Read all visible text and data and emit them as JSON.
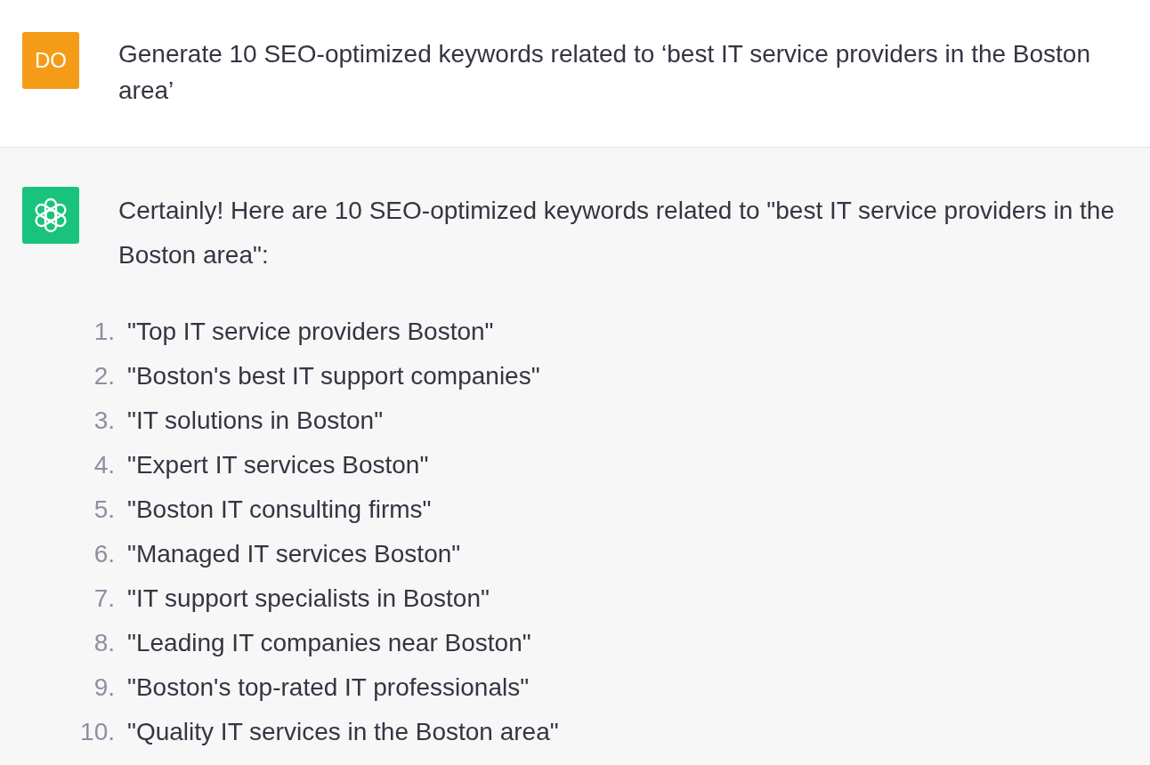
{
  "messages": [
    {
      "kind": "user",
      "avatar": "DO",
      "text": "Generate 10 SEO-optimized keywords related to ‘best IT service providers in the Boston area’"
    },
    {
      "kind": "assistant",
      "text": "Certainly! Here are 10 SEO-optimized keywords related to \"best IT service providers in the Boston area\":",
      "list": [
        {
          "number": "1.",
          "text": "\"Top IT service providers Boston\""
        },
        {
          "number": "2.",
          "text": "\"Boston's best IT support companies\""
        },
        {
          "number": "3.",
          "text": "\"IT solutions in Boston\""
        },
        {
          "number": "4.",
          "text": "\"Expert IT services Boston\""
        },
        {
          "number": "5.",
          "text": "\"Boston IT consulting firms\""
        },
        {
          "number": "6.",
          "text": "\"Managed IT services Boston\""
        },
        {
          "number": "7.",
          "text": "\"IT support specialists in Boston\""
        },
        {
          "number": "8.",
          "text": "\"Leading IT companies near Boston\""
        },
        {
          "number": "9.",
          "text": "\"Boston's top-rated IT professionals\""
        },
        {
          "number": "10.",
          "text": "\"Quality IT services in the Boston area\""
        }
      ]
    }
  ]
}
